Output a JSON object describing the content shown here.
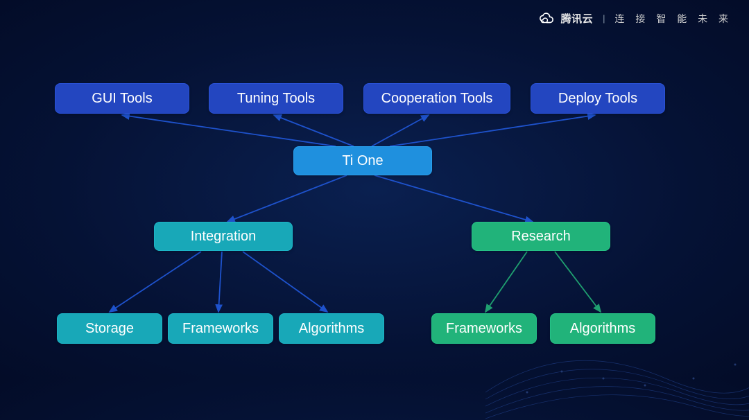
{
  "header": {
    "brand": "腾讯云",
    "tagline": "连 接 智 能 未 来"
  },
  "nodes": {
    "gui_tools": "GUI Tools",
    "tuning_tools": "Tuning Tools",
    "cooperation_tools": "Cooperation Tools",
    "deploy_tools": "Deploy Tools",
    "tione": "Ti One",
    "integration": "Integration",
    "research": "Research",
    "storage": "Storage",
    "frameworks_int": "Frameworks",
    "algorithms_int": "Algorithms",
    "frameworks_res": "Frameworks",
    "algorithms_res": "Algorithms"
  },
  "colors": {
    "blue": "#2346c0",
    "light_blue": "#1f90de",
    "teal": "#18a8b8",
    "green": "#21b37a",
    "background": "#051235",
    "connector_blue": "#1e52cc",
    "connector_green": "#1fa070"
  }
}
